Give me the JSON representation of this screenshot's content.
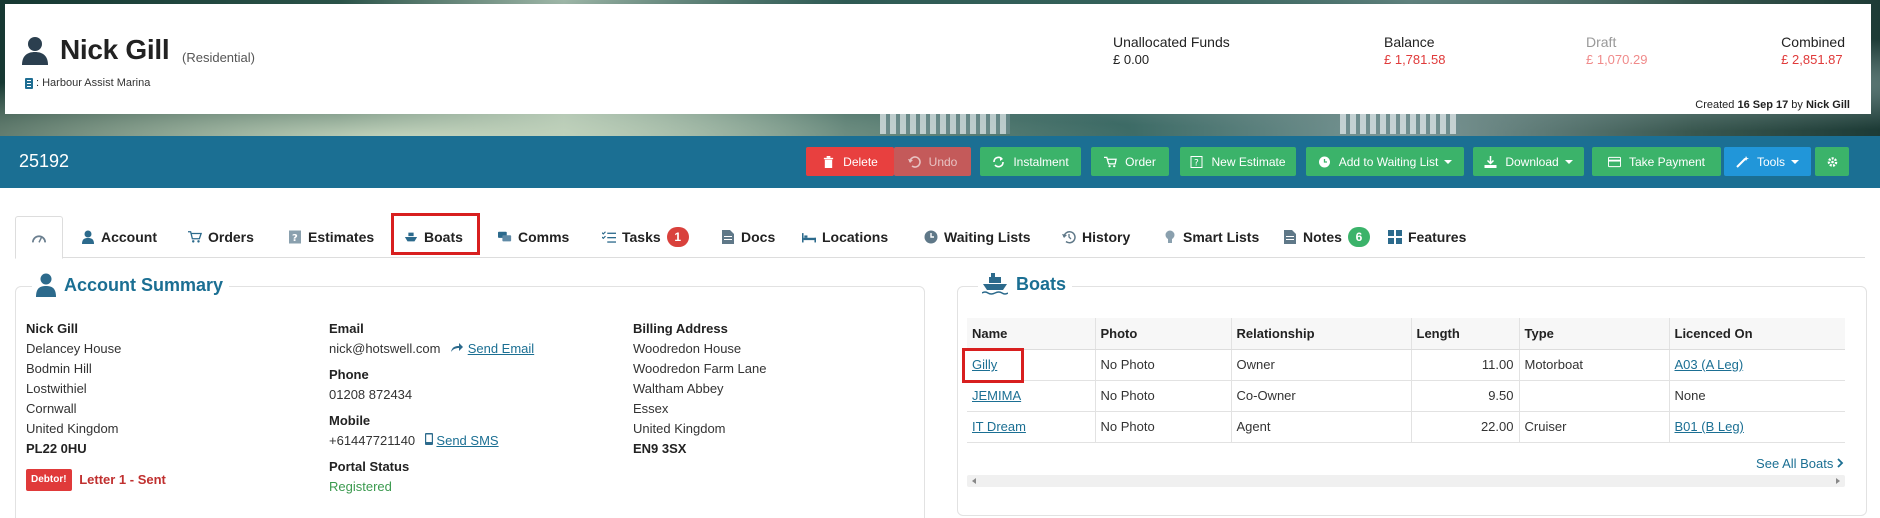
{
  "customer": {
    "name": "Nick Gill",
    "type": "(Residential)",
    "site": ": Harbour Assist Marina"
  },
  "stats": {
    "unallocated_label": "Unallocated Funds",
    "unallocated_value": "£ 0.00",
    "balance_label": "Balance",
    "balance_value": "£ 1,781.58",
    "draft_label": "Draft",
    "draft_value": "£ 1,070.29",
    "combined_label": "Combined",
    "combined_value": "£ 2,851.87"
  },
  "created": {
    "prefix": "Created",
    "date": "16 Sep 17",
    "by": "by",
    "author": "Nick Gill"
  },
  "record_id": "25192",
  "actions": {
    "delete": "Delete",
    "undo": "Undo",
    "instalment": "Instalment",
    "order": "Order",
    "new_estimate": "New Estimate",
    "waiting_list": "Add to Waiting List",
    "download": "Download",
    "take_payment": "Take Payment",
    "tools": "Tools"
  },
  "tabs": {
    "account": "Account",
    "orders": "Orders",
    "estimates": "Estimates",
    "boats": "Boats",
    "comms": "Comms",
    "tasks": "Tasks",
    "tasks_badge": "1",
    "docs": "Docs",
    "locations": "Locations",
    "waiting_lists": "Waiting Lists",
    "history": "History",
    "smart_lists": "Smart Lists",
    "notes": "Notes",
    "notes_badge": "6",
    "features": "Features"
  },
  "account_summary": {
    "title": "Account Summary",
    "address": {
      "name": "Nick Gill",
      "line1": "Delancey House",
      "line2": "Bodmin Hill",
      "line3": "Lostwithiel",
      "line4": "Cornwall",
      "line5": "United Kingdom",
      "postcode": "PL22 0HU"
    },
    "debtor_badge": "Debtor!",
    "letter_status": "Letter 1 - Sent",
    "email_label": "Email",
    "email": "nick@hotswell.com",
    "send_email": "Send Email",
    "phone_label": "Phone",
    "phone": "01208 872434",
    "mobile_label": "Mobile",
    "mobile": "+61447721140",
    "send_sms": "Send SMS",
    "portal_label": "Portal Status",
    "portal_status": "Registered",
    "billing": {
      "label": "Billing Address",
      "line1": "Woodredon House",
      "line2": "Woodredon Farm Lane",
      "line3": "Waltham Abbey",
      "line4": "Essex",
      "line5": "United Kingdom",
      "postcode": "EN9 3SX"
    }
  },
  "boats": {
    "title": "Boats",
    "columns": {
      "name": "Name",
      "photo": "Photo",
      "relationship": "Relationship",
      "length": "Length",
      "type": "Type",
      "licenced_on": "Licenced On"
    },
    "rows": [
      {
        "name": "Gilly",
        "photo": "No Photo",
        "relationship": "Owner",
        "length": "11.00",
        "type": "Motorboat",
        "licenced_on": "A03 (A Leg)"
      },
      {
        "name": "JEMIMA",
        "photo": "No Photo",
        "relationship": "Co-Owner",
        "length": "9.50",
        "type": "",
        "licenced_on": "None"
      },
      {
        "name": "IT Dream",
        "photo": "No Photo",
        "relationship": "Agent",
        "length": "22.00",
        "type": "Cruiser",
        "licenced_on": "B01 (B Leg)"
      }
    ],
    "see_all": "See All Boats"
  },
  "colors": {
    "brand_bar": "#1b6f93",
    "danger": "#e03a3a",
    "success": "#3bb36a",
    "info": "#2196d9"
  },
  "icons": {
    "person": "person-icon",
    "building": "building-icon",
    "dashboard": "dashboard-icon",
    "boat": "boat-icon"
  }
}
